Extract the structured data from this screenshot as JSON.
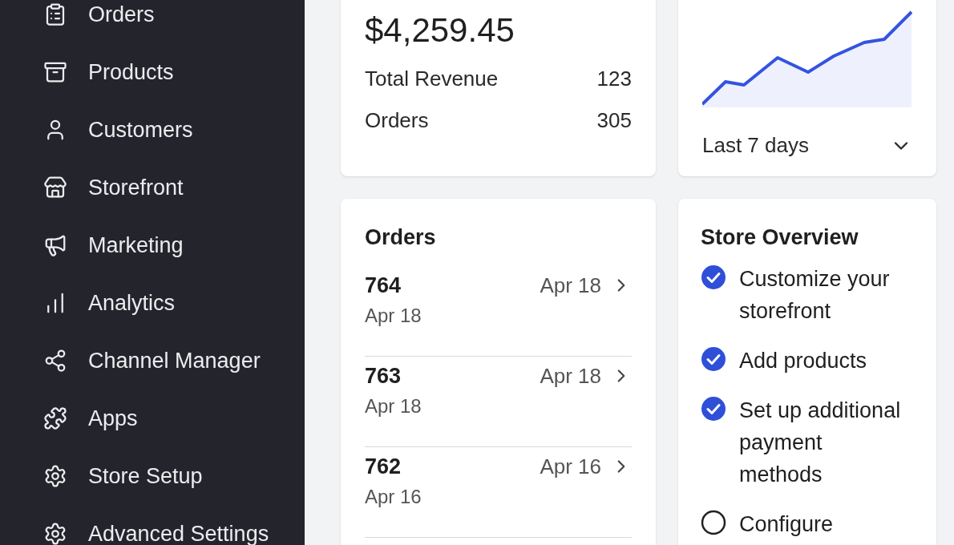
{
  "sidebar": {
    "items": [
      {
        "label": "Orders",
        "kind": "orders"
      },
      {
        "label": "Products",
        "kind": "products"
      },
      {
        "label": "Customers",
        "kind": "customers"
      },
      {
        "label": "Storefront",
        "kind": "storefront"
      },
      {
        "label": "Marketing",
        "kind": "marketing"
      },
      {
        "label": "Analytics",
        "kind": "analytics"
      },
      {
        "label": "Channel Manager",
        "kind": "channels"
      },
      {
        "label": "Apps",
        "kind": "apps"
      },
      {
        "label": "Store Setup",
        "kind": "settings"
      },
      {
        "label": "Advanced Settings",
        "kind": "settings"
      }
    ]
  },
  "revenue_card": {
    "amount": "$4,259.45",
    "rows": [
      {
        "label": "Total Revenue",
        "value": "123"
      },
      {
        "label": "Orders",
        "value": "305"
      }
    ]
  },
  "sales_card": {
    "period": "Last 7 days"
  },
  "orders_card": {
    "title": "Orders",
    "rows": [
      {
        "number": "764",
        "date": "Apr 18",
        "subdate": "Apr 18"
      },
      {
        "number": "763",
        "date": "Apr 18",
        "subdate": "Apr 18"
      },
      {
        "number": "762",
        "date": "Apr 16",
        "subdate": "Apr 16"
      }
    ]
  },
  "overview_card": {
    "title": "Store Overview",
    "tasks": [
      {
        "label": "Customize your storefront",
        "checked": true
      },
      {
        "label": "Add products",
        "checked": true
      },
      {
        "label": "Set up additional payment methods",
        "checked": true
      },
      {
        "label": "Configure",
        "checked": false
      }
    ]
  }
}
